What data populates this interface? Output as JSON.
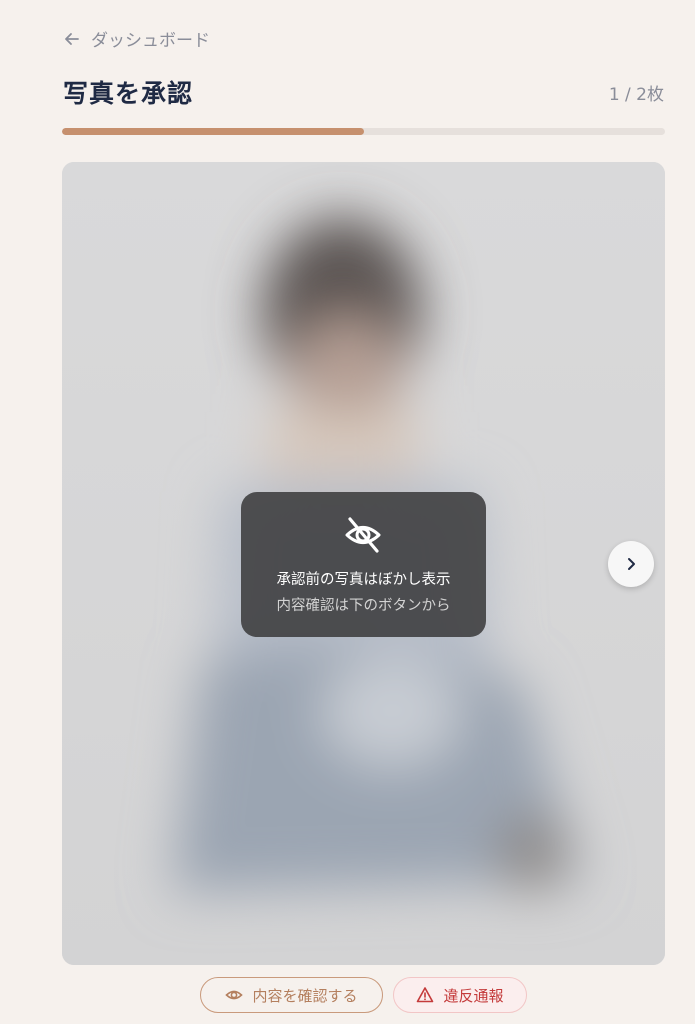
{
  "nav": {
    "back_label": "ダッシュボード"
  },
  "header": {
    "title": "写真を承認",
    "counter": "1 / 2枚"
  },
  "progress": {
    "fraction": 0.5
  },
  "photo": {
    "notice_line1": "承認前の写真はぼかし表示",
    "notice_line2": "内容確認は下のボタンから"
  },
  "actions": {
    "confirm_label": "内容を確認する",
    "report_label": "違反通報"
  },
  "icons": {
    "back": "arrow-left-icon",
    "hidden": "eye-off-icon",
    "next": "chevron-right-icon",
    "confirm": "eye-icon",
    "report": "warning-triangle-icon"
  },
  "colors": {
    "background": "#f6f1ed",
    "accent": "#c6906e",
    "title": "#1f2a44",
    "danger": "#c43b3b"
  }
}
